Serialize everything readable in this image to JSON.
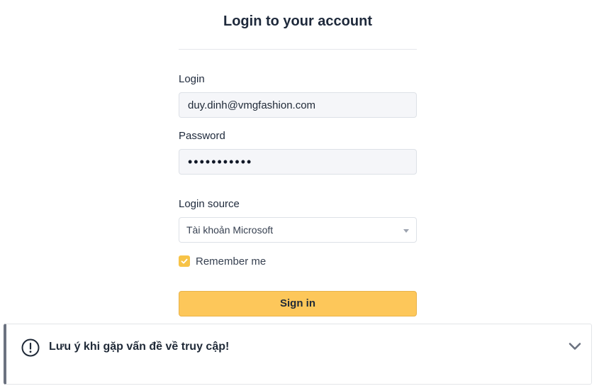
{
  "header": {
    "title": "Login to your account"
  },
  "form": {
    "login_label": "Login",
    "login_value": "duy.dinh@vmgfashion.com",
    "password_label": "Password",
    "password_value": "•••••••••••",
    "source_label": "Login source",
    "source_selected": "Tài khoản Microsoft",
    "remember_label": "Remember me",
    "remember_checked": true,
    "signin_label": "Sign in"
  },
  "notice": {
    "title": "Lưu ý khi gặp vấn đề về truy cập!",
    "icon": "exclamation-circle-icon",
    "chevron": "chevron-down-icon"
  },
  "colors": {
    "accent": "#fdc75a",
    "checkbox": "#f7c347",
    "notice_border": "#6b7280"
  }
}
